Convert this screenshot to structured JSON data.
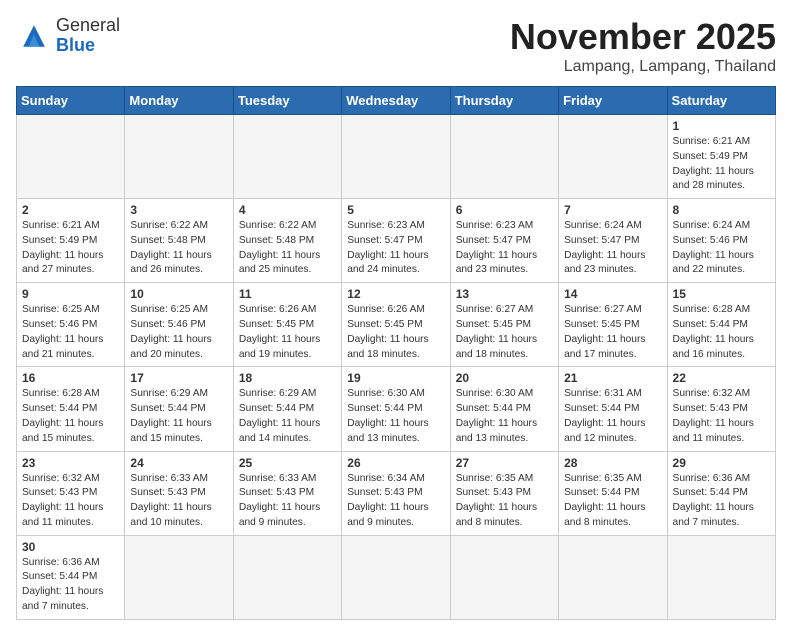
{
  "header": {
    "logo_general": "General",
    "logo_blue": "Blue",
    "month_title": "November 2025",
    "location": "Lampang, Lampang, Thailand"
  },
  "weekdays": [
    "Sunday",
    "Monday",
    "Tuesday",
    "Wednesday",
    "Thursday",
    "Friday",
    "Saturday"
  ],
  "days": [
    {
      "day": "",
      "info": ""
    },
    {
      "day": "",
      "info": ""
    },
    {
      "day": "",
      "info": ""
    },
    {
      "day": "",
      "info": ""
    },
    {
      "day": "",
      "info": ""
    },
    {
      "day": "",
      "info": ""
    },
    {
      "day": "1",
      "info": "Sunrise: 6:21 AM\nSunset: 5:49 PM\nDaylight: 11 hours\nand 28 minutes."
    },
    {
      "day": "2",
      "info": "Sunrise: 6:21 AM\nSunset: 5:49 PM\nDaylight: 11 hours\nand 27 minutes."
    },
    {
      "day": "3",
      "info": "Sunrise: 6:22 AM\nSunset: 5:48 PM\nDaylight: 11 hours\nand 26 minutes."
    },
    {
      "day": "4",
      "info": "Sunrise: 6:22 AM\nSunset: 5:48 PM\nDaylight: 11 hours\nand 25 minutes."
    },
    {
      "day": "5",
      "info": "Sunrise: 6:23 AM\nSunset: 5:47 PM\nDaylight: 11 hours\nand 24 minutes."
    },
    {
      "day": "6",
      "info": "Sunrise: 6:23 AM\nSunset: 5:47 PM\nDaylight: 11 hours\nand 23 minutes."
    },
    {
      "day": "7",
      "info": "Sunrise: 6:24 AM\nSunset: 5:47 PM\nDaylight: 11 hours\nand 23 minutes."
    },
    {
      "day": "8",
      "info": "Sunrise: 6:24 AM\nSunset: 5:46 PM\nDaylight: 11 hours\nand 22 minutes."
    },
    {
      "day": "9",
      "info": "Sunrise: 6:25 AM\nSunset: 5:46 PM\nDaylight: 11 hours\nand 21 minutes."
    },
    {
      "day": "10",
      "info": "Sunrise: 6:25 AM\nSunset: 5:46 PM\nDaylight: 11 hours\nand 20 minutes."
    },
    {
      "day": "11",
      "info": "Sunrise: 6:26 AM\nSunset: 5:45 PM\nDaylight: 11 hours\nand 19 minutes."
    },
    {
      "day": "12",
      "info": "Sunrise: 6:26 AM\nSunset: 5:45 PM\nDaylight: 11 hours\nand 18 minutes."
    },
    {
      "day": "13",
      "info": "Sunrise: 6:27 AM\nSunset: 5:45 PM\nDaylight: 11 hours\nand 18 minutes."
    },
    {
      "day": "14",
      "info": "Sunrise: 6:27 AM\nSunset: 5:45 PM\nDaylight: 11 hours\nand 17 minutes."
    },
    {
      "day": "15",
      "info": "Sunrise: 6:28 AM\nSunset: 5:44 PM\nDaylight: 11 hours\nand 16 minutes."
    },
    {
      "day": "16",
      "info": "Sunrise: 6:28 AM\nSunset: 5:44 PM\nDaylight: 11 hours\nand 15 minutes."
    },
    {
      "day": "17",
      "info": "Sunrise: 6:29 AM\nSunset: 5:44 PM\nDaylight: 11 hours\nand 15 minutes."
    },
    {
      "day": "18",
      "info": "Sunrise: 6:29 AM\nSunset: 5:44 PM\nDaylight: 11 hours\nand 14 minutes."
    },
    {
      "day": "19",
      "info": "Sunrise: 6:30 AM\nSunset: 5:44 PM\nDaylight: 11 hours\nand 13 minutes."
    },
    {
      "day": "20",
      "info": "Sunrise: 6:30 AM\nSunset: 5:44 PM\nDaylight: 11 hours\nand 13 minutes."
    },
    {
      "day": "21",
      "info": "Sunrise: 6:31 AM\nSunset: 5:44 PM\nDaylight: 11 hours\nand 12 minutes."
    },
    {
      "day": "22",
      "info": "Sunrise: 6:32 AM\nSunset: 5:43 PM\nDaylight: 11 hours\nand 11 minutes."
    },
    {
      "day": "23",
      "info": "Sunrise: 6:32 AM\nSunset: 5:43 PM\nDaylight: 11 hours\nand 11 minutes."
    },
    {
      "day": "24",
      "info": "Sunrise: 6:33 AM\nSunset: 5:43 PM\nDaylight: 11 hours\nand 10 minutes."
    },
    {
      "day": "25",
      "info": "Sunrise: 6:33 AM\nSunset: 5:43 PM\nDaylight: 11 hours\nand 9 minutes."
    },
    {
      "day": "26",
      "info": "Sunrise: 6:34 AM\nSunset: 5:43 PM\nDaylight: 11 hours\nand 9 minutes."
    },
    {
      "day": "27",
      "info": "Sunrise: 6:35 AM\nSunset: 5:43 PM\nDaylight: 11 hours\nand 8 minutes."
    },
    {
      "day": "28",
      "info": "Sunrise: 6:35 AM\nSunset: 5:44 PM\nDaylight: 11 hours\nand 8 minutes."
    },
    {
      "day": "29",
      "info": "Sunrise: 6:36 AM\nSunset: 5:44 PM\nDaylight: 11 hours\nand 7 minutes."
    },
    {
      "day": "30",
      "info": "Sunrise: 6:36 AM\nSunset: 5:44 PM\nDaylight: 11 hours\nand 7 minutes."
    },
    {
      "day": "",
      "info": ""
    },
    {
      "day": "",
      "info": ""
    },
    {
      "day": "",
      "info": ""
    },
    {
      "day": "",
      "info": ""
    },
    {
      "day": "",
      "info": ""
    },
    {
      "day": "",
      "info": ""
    }
  ]
}
